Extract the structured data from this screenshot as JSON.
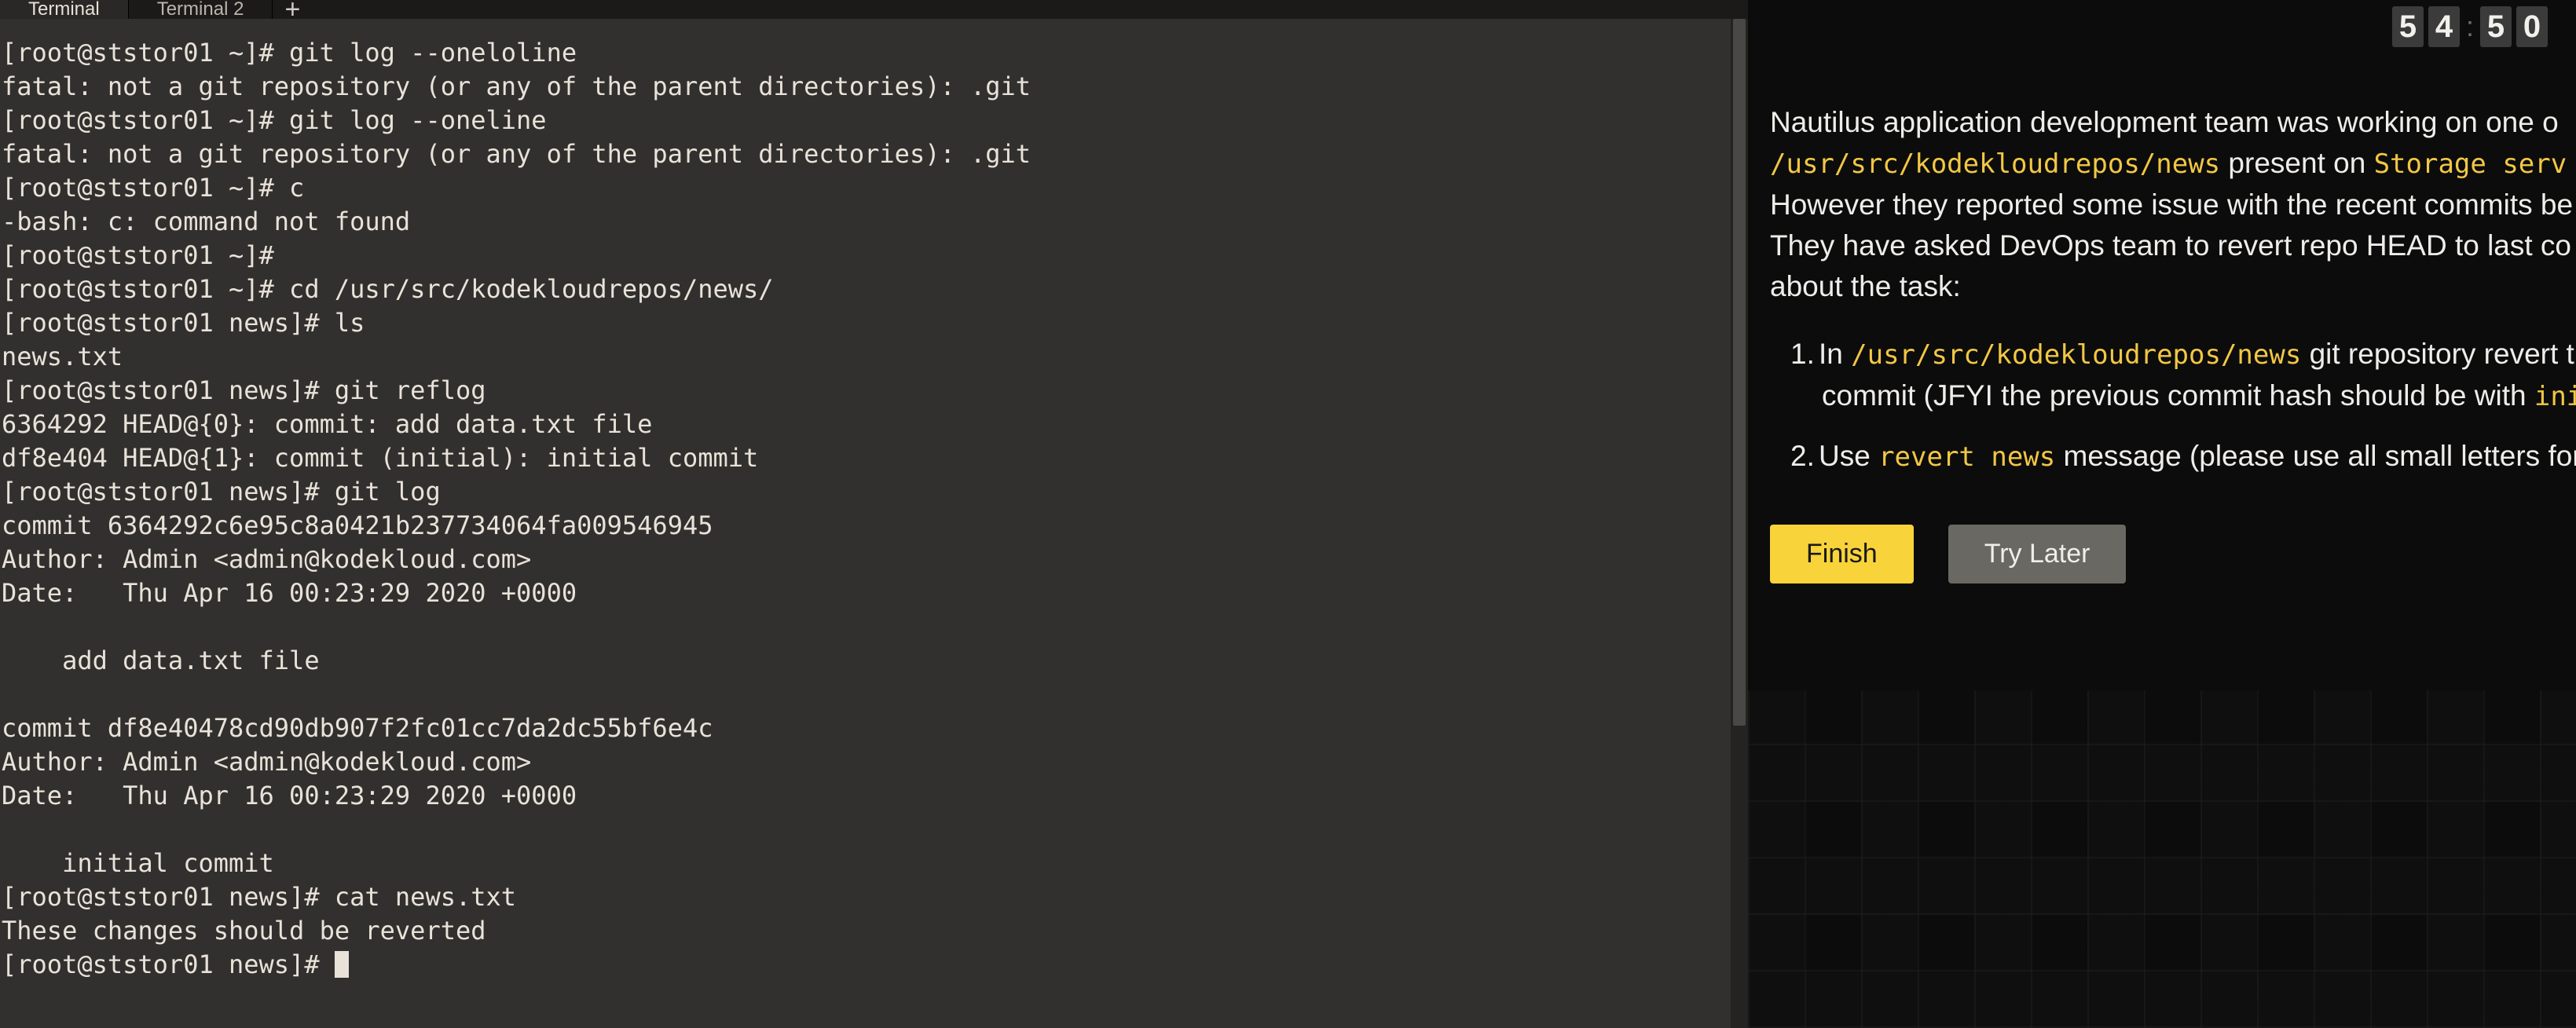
{
  "tabs": {
    "items": [
      {
        "label": "Terminal",
        "active": true
      },
      {
        "label": "Terminal 2",
        "active": false
      }
    ],
    "add_glyph": "+"
  },
  "terminal": {
    "lines": [
      "[root@ststor01 ~]# git log --oneloline",
      "fatal: not a git repository (or any of the parent directories): .git",
      "[root@ststor01 ~]# git log --oneline",
      "fatal: not a git repository (or any of the parent directories): .git",
      "[root@ststor01 ~]# c",
      "-bash: c: command not found",
      "[root@ststor01 ~]#",
      "[root@ststor01 ~]# cd /usr/src/kodekloudrepos/news/",
      "[root@ststor01 news]# ls",
      "news.txt",
      "[root@ststor01 news]# git reflog",
      "6364292 HEAD@{0}: commit: add data.txt file",
      "df8e404 HEAD@{1}: commit (initial): initial commit",
      "[root@ststor01 news]# git log",
      "commit 6364292c6e95c8a0421b237734064fa009546945",
      "Author: Admin <admin@kodekloud.com>",
      "Date:   Thu Apr 16 00:23:29 2020 +0000",
      "",
      "    add data.txt file",
      "",
      "commit df8e40478cd90db907f2fc01cc7da2dc55bf6e4c",
      "Author: Admin <admin@kodekloud.com>",
      "Date:   Thu Apr 16 00:23:29 2020 +0000",
      "",
      "    initial commit",
      "[root@ststor01 news]# cat news.txt",
      "These changes should be reverted",
      "[root@ststor01 news]# "
    ]
  },
  "timer": {
    "d1": "5",
    "d2": "4",
    "d3": "5",
    "d4": "0",
    "colon": ":"
  },
  "task": {
    "p1_a": "Nautilus application development team was working on one o",
    "p2_code1": "/usr/src/kodekloudrepos/news",
    "p2_mid": " present on ",
    "p2_code2": "Storage serv",
    "p3": "However they reported some issue with the recent commits be",
    "p4": "They have asked DevOps team to revert repo HEAD to last co",
    "p5": "about the task:",
    "li1_a": "In ",
    "li1_code": "/usr/src/kodekloudrepos/news",
    "li1_b": " git repository revert the latest ",
    "li1_c": "commit (JFYI the previous commit hash should be with ",
    "li1_code2": "initial com",
    "li2_a": "Use ",
    "li2_code": "revert news",
    "li2_b": " message (please use all small letters for commit m",
    "finish": "Finish",
    "try_later": "Try Later"
  }
}
